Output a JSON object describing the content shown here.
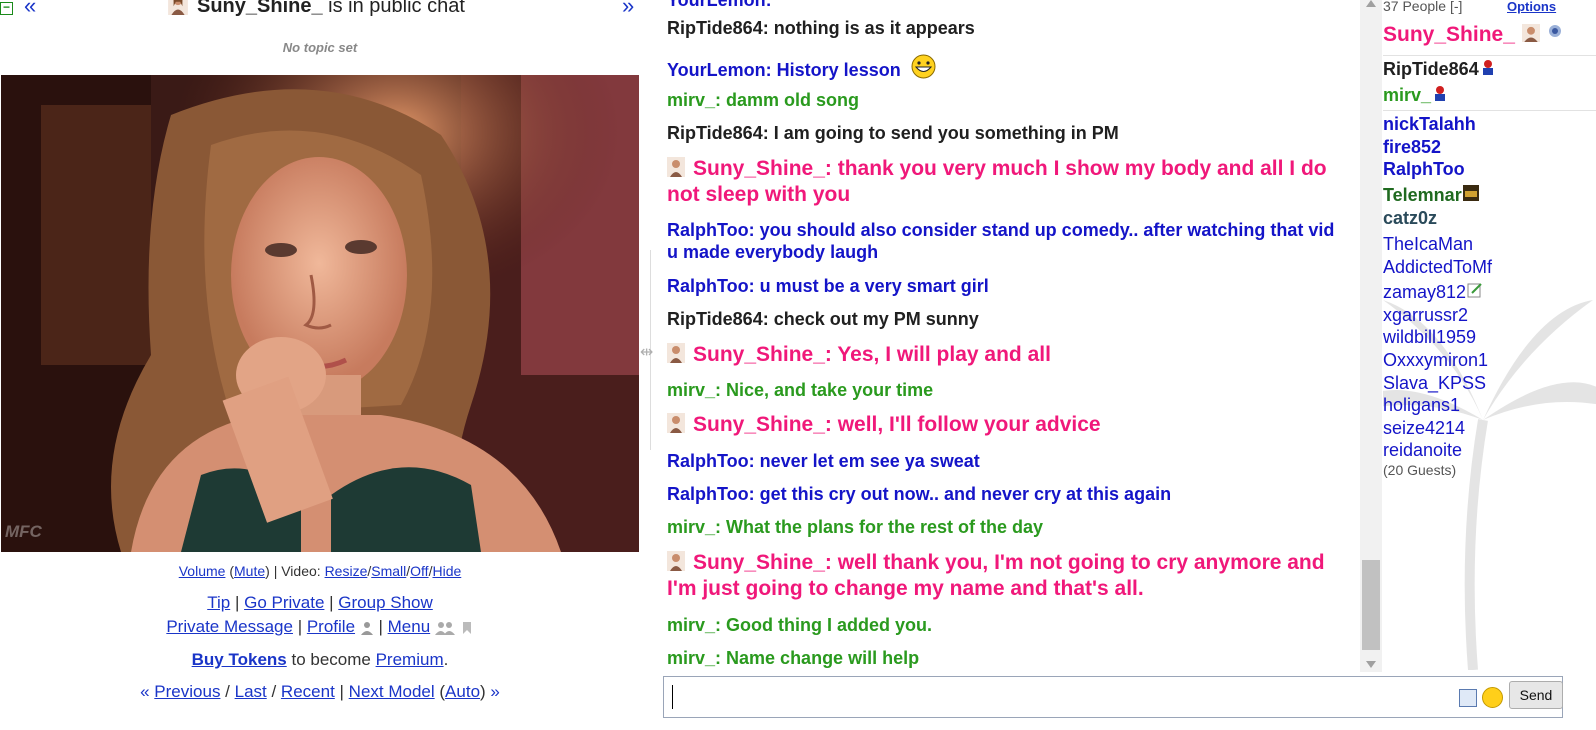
{
  "header": {
    "model_name": "Suny_Shine_",
    "status_text": "is in public chat",
    "topic": "No topic set",
    "nav_left": "«",
    "nav_right": "»"
  },
  "video": {
    "watermark": "MFC"
  },
  "controls": {
    "volume": "Volume",
    "mute": "Mute",
    "video_label": "| Video:",
    "resize": "Resize",
    "small": "Small",
    "off": "Off",
    "hide": "Hide",
    "tip": "Tip",
    "go_private": "Go Private",
    "group_show": "Group Show",
    "private_message": "Private Message",
    "profile": "Profile",
    "menu": "Menu",
    "buy_tokens": "Buy Tokens",
    "become_text": "to become",
    "premium": "Premium",
    "previous": "Previous",
    "last": "Last",
    "recent": "Recent",
    "next_model": "Next Model",
    "auto": "Auto"
  },
  "chat": {
    "top_fragment": "YourLemon:",
    "messages": [
      {
        "text": "RipTide864: nothing is as it appears",
        "color": "#202020"
      },
      {
        "text": "YourLemon: History lesson",
        "color": "#1414c8"
      },
      {
        "text": "mirv_: damm old song",
        "color": "#2a9a1e"
      },
      {
        "text": "RipTide864: I am going to send you something in PM",
        "color": "#202020"
      },
      {
        "text": "Suny_Shine_: thank you very much I show my body and all I do not sleep with you",
        "color": "#f0187a"
      },
      {
        "text": "RalphToo: you should also consider stand up comedy.. after watching that vid u made everybody laugh",
        "color": "#1414c8"
      },
      {
        "text": "RalphToo: u must be a very smart girl",
        "color": "#1414c8"
      },
      {
        "text": "RipTide864: check out my PM sunny",
        "color": "#202020"
      },
      {
        "text": "Suny_Shine_: Yes, I will play and all",
        "color": "#f0187a"
      },
      {
        "text": "mirv_: Nice, and take your time",
        "color": "#2a9a1e"
      },
      {
        "text": "Suny_Shine_: well, I'll follow your advice",
        "color": "#f0187a"
      },
      {
        "text": "RalphToo: never let em see ya sweat",
        "color": "#1414c8"
      },
      {
        "text": "RalphToo: get this cry out now.. and never cry at this again",
        "color": "#1414c8"
      },
      {
        "text": "mirv_: What the plans for the rest of the day",
        "color": "#2a9a1e"
      },
      {
        "text": "Suny_Shine_: well thank you, I'm not going to cry anymore and I'm just going to change my name and that's all.",
        "color": "#f0187a"
      },
      {
        "text": "mirv_: Good thing I added you.",
        "color": "#2a9a1e"
      },
      {
        "text": "mirv_: Name change will help",
        "color": "#2a9a1e"
      }
    ],
    "send_label": "Send"
  },
  "userlist": {
    "people_count": "37 People [-]",
    "options": "Options",
    "model": "Suny_Shine_",
    "premium_users": [
      {
        "name": "RipTide864",
        "color": "#202020"
      },
      {
        "name": "mirv_",
        "color": "#2a9a1e"
      }
    ],
    "bold_users": [
      {
        "name": "nickTalahh",
        "color": "#1414c8"
      },
      {
        "name": "fire852",
        "color": "#1414c8"
      },
      {
        "name": "RalphToo",
        "color": "#1414c8"
      },
      {
        "name": "Telemnar",
        "color": "#1f6a1f"
      },
      {
        "name": "catz0z",
        "color": "#2a4a5a"
      }
    ],
    "basic_users": [
      "TheIcaMan",
      "AddictedToMf",
      "zamay812",
      "xgarrussr2",
      "wildbill1959",
      "Oxxxymiron1",
      "Slava_KPSS",
      "holigans1",
      "seize4214",
      "reidanoite"
    ],
    "guests": "(20 Guests)"
  }
}
